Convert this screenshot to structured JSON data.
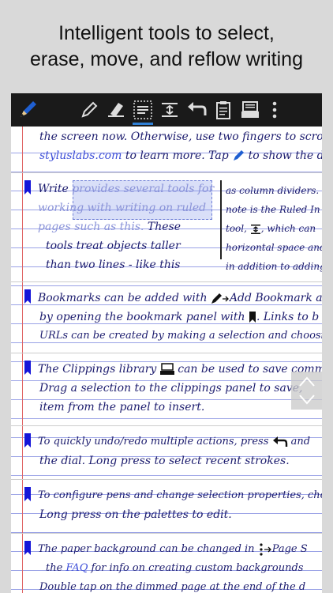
{
  "headline": {
    "line1": "Intelligent tools to select,",
    "line2": "erase, move, and reflow writing"
  },
  "toolbar": {
    "icons": [
      "app-pen-icon",
      "pen-icon",
      "highlighter-icon",
      "select-ruled-icon",
      "insert-space-icon",
      "undo-icon",
      "clipboard-icon",
      "clippings-icon",
      "more-icon"
    ],
    "active_index": 3
  },
  "notes": {
    "l1": "the screen now. Otherwise, use two fingers to scroll.",
    "l2a": "styluslabs.com",
    "l2b": " to learn more. Tap ",
    "l2c": " to show the doc",
    "b1_l1a": "Write ",
    "b1_l1b": "provides several tools for",
    "b1_l2": "working with writing on ruled",
    "b1_l3a": "pages such as this.",
    "b1_l3b": " These",
    "b1_l4": "tools treat objects taller",
    "b1_l5": "than two lines - like this",
    "b1_r1": "as column dividers.",
    "b1_r2": "note is the Ruled In",
    "b1_r3a": "tool, ",
    "b1_r3b": ", which can",
    "b1_r4": "horizontal space and",
    "b1_r5": "in addition to adding v",
    "b2_l1a": "Bookmarks can be added with ",
    "b2_l1b": "Add Bookmark an",
    "b2_l2": "by opening the bookmark panel with",
    "b2_l2b": ". Links to b",
    "b2_l3": "URLs can be created by making a selection and choosing",
    "b3_l1a": "The Clippings library ",
    "b3_l1b": " can be used to save commonly",
    "b3_l2": "Drag a selection to the clippings panel to save,",
    "b3_l3": "item from the panel to insert.",
    "b4_l1a": "To quickly undo/redo multiple actions, press ",
    "b4_l1b": " and",
    "b4_l2": "the dial. Long press to select recent strokes.",
    "b5_l1": "To configure pens and change selection properties, choose",
    "b5_l2": "Long press on the palettes to edit.",
    "b6_l1a": "The paper background can be changed in ",
    "b6_l1b": "Page S",
    "b6_l2a": "the ",
    "b6_l2b": "FAQ",
    "b6_l2c": " for info on creating custom backgrounds",
    "b6_l3": "Double tap on the dimmed page at the end of the d"
  },
  "colors": {
    "ink": "#1c1c6e",
    "bookmark": "#1515d8",
    "link": "#3d4ed8",
    "ruling": "#9aa2e6",
    "margin": "#e06464",
    "toolbar": "#1a1a1a",
    "active": "#2f80d6"
  }
}
